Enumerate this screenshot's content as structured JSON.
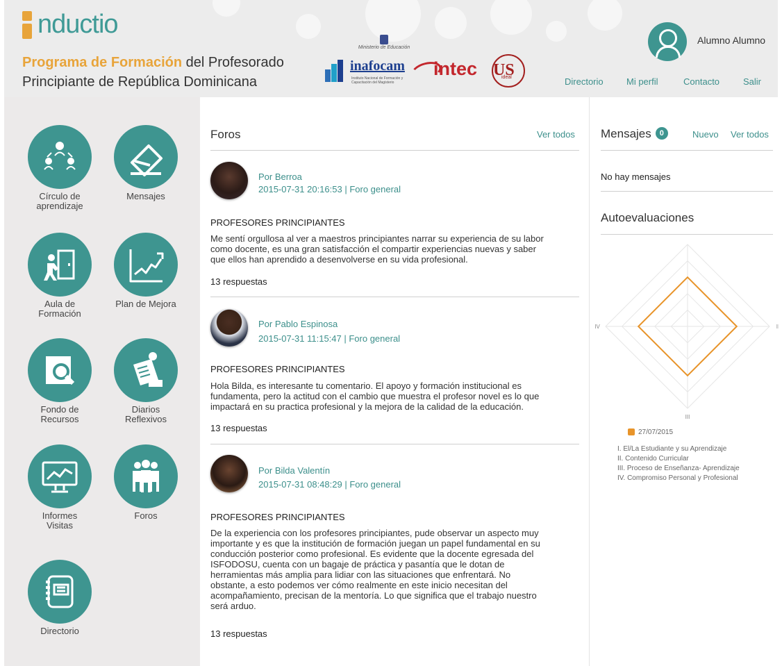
{
  "header": {
    "brand": "nductio",
    "program_highlight": "Programa de Formación",
    "program_rest": " del Profesorado",
    "program_line2": "Principiante de República Dominicana",
    "partners": {
      "ministerio": "Ministerio de Educación",
      "inafocam": "inafocam",
      "inafocam_sub": "Instituto Nacional de Formación y Capacitación del Magisterio",
      "intec": "intec",
      "us_ideal": "ideal"
    },
    "user_name": "Alumno Alumno",
    "nav": [
      "Directorio",
      "Mi perfil",
      "Contacto",
      "Salir"
    ]
  },
  "sidebar": {
    "tiles": [
      {
        "label": "Círculo de aprendizaje",
        "icon": "learning-circle-icon"
      },
      {
        "label": "Mensajes",
        "icon": "envelope-icon"
      },
      {
        "label": "Aula de Formación",
        "icon": "classroom-door-icon"
      },
      {
        "label": "Plan de Mejora",
        "icon": "growth-chart-icon"
      },
      {
        "label": "Fondo de Recursos",
        "icon": "search-document-icon"
      },
      {
        "label": "Diarios Reflexivos",
        "icon": "newspaper-reader-icon"
      },
      {
        "label": "Informes Visitas",
        "icon": "monitor-chart-icon"
      },
      {
        "label": "Foros",
        "icon": "group-icon"
      },
      {
        "label": "Directorio",
        "icon": "address-book-icon"
      }
    ]
  },
  "forums": {
    "title": "Foros",
    "view_all": "Ver todos",
    "posts": [
      {
        "author": "Por Berroa",
        "meta": "2015-07-31 20:16:53 | Foro general",
        "title": "PROFESORES PRINCIPIANTES",
        "lines": [
          "Me sentí orgullosa al ver a maestros principiantes narrar su experiencia de su labor",
          "como docente, es una gran satisfacción el compartir experiencias nuevas y saber",
          "que ellos han aprendido a desenvolverse en su vida profesional."
        ],
        "replies": "13 respuestas"
      },
      {
        "author": "Por Pablo Espinosa",
        "meta": "2015-07-31 11:15:47 | Foro general",
        "title": "PROFESORES PRINCIPIANTES",
        "lines": [
          "Hola Bilda, es interesante tu comentario. El apoyo y formación institucional es",
          "fundamenta, pero la actitud con el cambio que muestra el profesor novel es lo que",
          "impactará en su practica profesional y la mejora de la calidad de la educación."
        ],
        "replies": "13 respuestas"
      },
      {
        "author": "Por Bilda Valentín",
        "meta": "2015-07-31 08:48:29 | Foro general",
        "title": "PROFESORES PRINCIPIANTES",
        "lines": [
          "De la experiencia con los profesores principiantes, pude observar un aspecto muy",
          "importante y es que la institución de formación juegan un papel fundamental en su",
          "conducción posterior como profesional. Es evidente que la docente egresada del",
          "ISFODOSU, cuenta con un bagaje de práctica y pasantía que le dotan de",
          "herramientas más amplia para lidiar con las situaciones que enfrentará. No",
          "obstante, a esto podemos ver cómo realmente en este inicio necesitan del",
          "acompañamiento, precisan de la mentoría. Lo que significa que el trabajo nuestro",
          "será arduo."
        ],
        "replies": "13 respuestas"
      }
    ]
  },
  "messages": {
    "title": "Mensajes",
    "count": "0",
    "new": "Nuevo",
    "view_all": "Ver todos",
    "empty": "No hay mensajes"
  },
  "self_eval": {
    "title": "Autoevaluaciones",
    "legend_date": "27/07/2015",
    "legend_color": "#e8942a",
    "items": [
      "I.  El/La Estudiante y su Aprendizaje",
      "II.  Contenido Curricular",
      "III.  Proceso de Enseñanza- Aprendizaje",
      "IV.  Compromiso Personal y Profesional"
    ]
  },
  "chart_data": {
    "type": "radar",
    "axes": [
      "I",
      "II",
      "III",
      "IV"
    ],
    "series": [
      {
        "name": "27/07/2015",
        "values": [
          3,
          3,
          3,
          3
        ]
      }
    ],
    "rlim": [
      0,
      5
    ],
    "grid_levels": 5
  }
}
